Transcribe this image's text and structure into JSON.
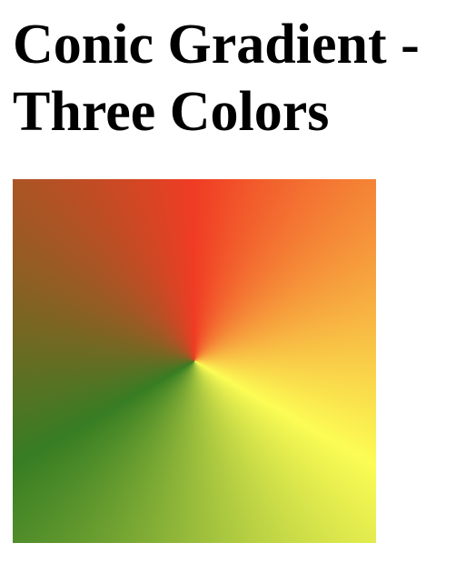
{
  "page": {
    "title": "Conic Gradient - Three Colors"
  },
  "gradient": {
    "type": "conic",
    "colors": [
      "#f03c24",
      "#fcfc54",
      "#377d23"
    ]
  }
}
